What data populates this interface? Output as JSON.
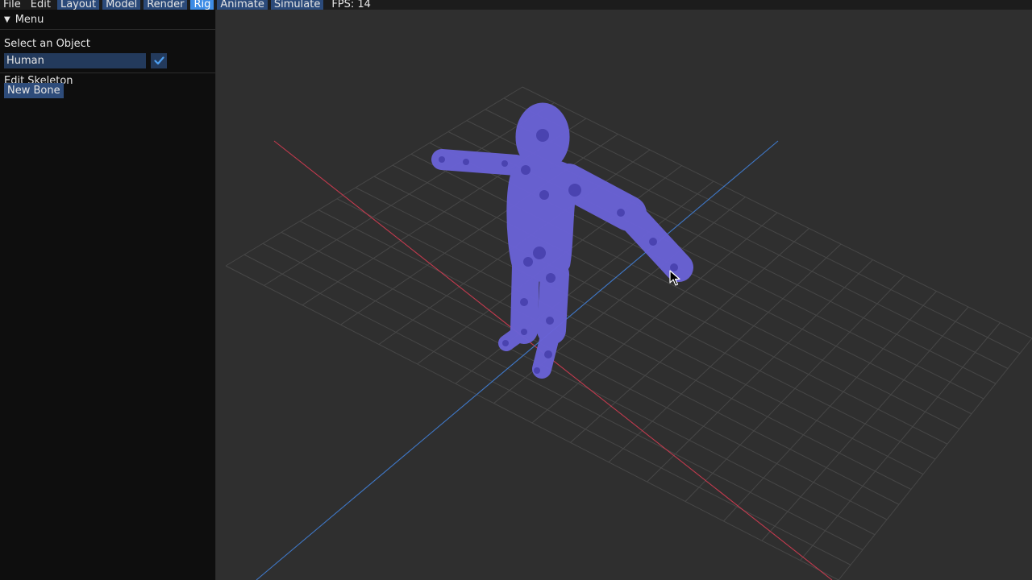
{
  "menubar": {
    "items": [
      "File",
      "Edit",
      "Layout",
      "Model",
      "Render",
      "Rig",
      "Animate",
      "Simulate"
    ],
    "active": "Rig",
    "fps_label": "FPS: 14"
  },
  "panel": {
    "title": "Menu",
    "select_label": "Select an Object",
    "selected_object": "Human",
    "object_checked": true,
    "edit_label": "Edit Skeleton",
    "new_bone_label": "New Bone"
  },
  "colors": {
    "model": "#6a62d6",
    "joint": "#4a43b0",
    "grid": "#474747",
    "x_axis": "#c43a4e",
    "z_axis": "#3f78c8",
    "active_tab": "#3d8ce6"
  }
}
